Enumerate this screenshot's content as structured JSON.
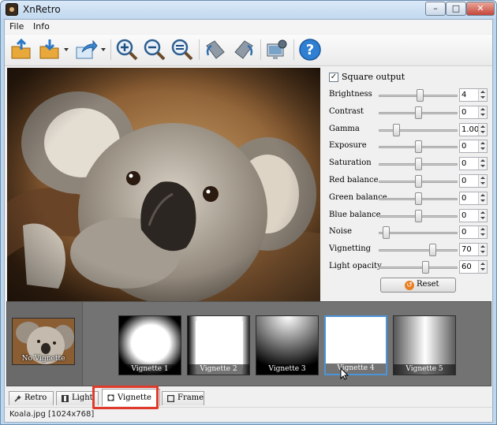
{
  "window": {
    "title": "XnRetro",
    "min_glyph": "–",
    "max_glyph": "□",
    "close_glyph": "✕"
  },
  "menu": [
    {
      "label": "File"
    },
    {
      "label": "Info"
    }
  ],
  "toolbar": {
    "buttons": [
      {
        "icon": "open-icon"
      },
      {
        "icon": "save-icon"
      },
      {
        "icon": "export-icon"
      },
      {
        "icon": "zoom-in-icon"
      },
      {
        "icon": "zoom-out-icon"
      },
      {
        "icon": "zoom-fit-icon"
      },
      {
        "icon": "rotate-left-icon"
      },
      {
        "icon": "rotate-right-icon"
      },
      {
        "icon": "wallpaper-icon"
      },
      {
        "icon": "help-icon"
      }
    ],
    "help_glyph": "?"
  },
  "adjust": {
    "square_output": {
      "label": "Square output",
      "checked": true,
      "check_glyph": "✓"
    },
    "sliders": [
      {
        "label": "Brightness",
        "value": "4",
        "position": 0.52
      },
      {
        "label": "Contrast",
        "value": "0",
        "position": 0.5
      },
      {
        "label": "Gamma",
        "value": "1.00",
        "position": 0.2
      },
      {
        "label": "Exposure",
        "value": "0",
        "position": 0.5
      },
      {
        "label": "Saturation",
        "value": "0",
        "position": 0.5
      },
      {
        "label": "Red balance",
        "value": "0",
        "position": 0.5
      },
      {
        "label": "Green balance",
        "value": "0",
        "position": 0.5
      },
      {
        "label": "Blue balance",
        "value": "0",
        "position": 0.5
      },
      {
        "label": "Noise",
        "value": "0",
        "position": 0.05
      },
      {
        "label": "Vignetting",
        "value": "70",
        "position": 0.7
      },
      {
        "label": "Light opacity",
        "value": "60",
        "position": 0.6
      }
    ],
    "reset_label": "Reset",
    "reset_glyph": "↺"
  },
  "presets": {
    "first": {
      "label": "No Vignette"
    },
    "items": [
      {
        "label": "Vignette 1",
        "selected": false
      },
      {
        "label": "Vignette 2",
        "selected": false
      },
      {
        "label": "Vignette 3",
        "selected": false
      },
      {
        "label": "Vignette 4",
        "selected": true
      },
      {
        "label": "Vignette 5",
        "selected": false
      }
    ]
  },
  "tabs": [
    {
      "label": "Retro",
      "active": false,
      "icon": "wand-icon"
    },
    {
      "label": "Light",
      "active": false,
      "icon": "film-icon"
    },
    {
      "label": "Vignette",
      "active": true,
      "icon": "vignette-icon"
    },
    {
      "label": "Frame",
      "active": false,
      "icon": "frame-icon"
    }
  ],
  "status": {
    "text": "Koala.jpg [1024x768]"
  },
  "colors": {
    "accent": "#4d94d8",
    "highlight": "#e03a2a",
    "strip": "#737373"
  }
}
